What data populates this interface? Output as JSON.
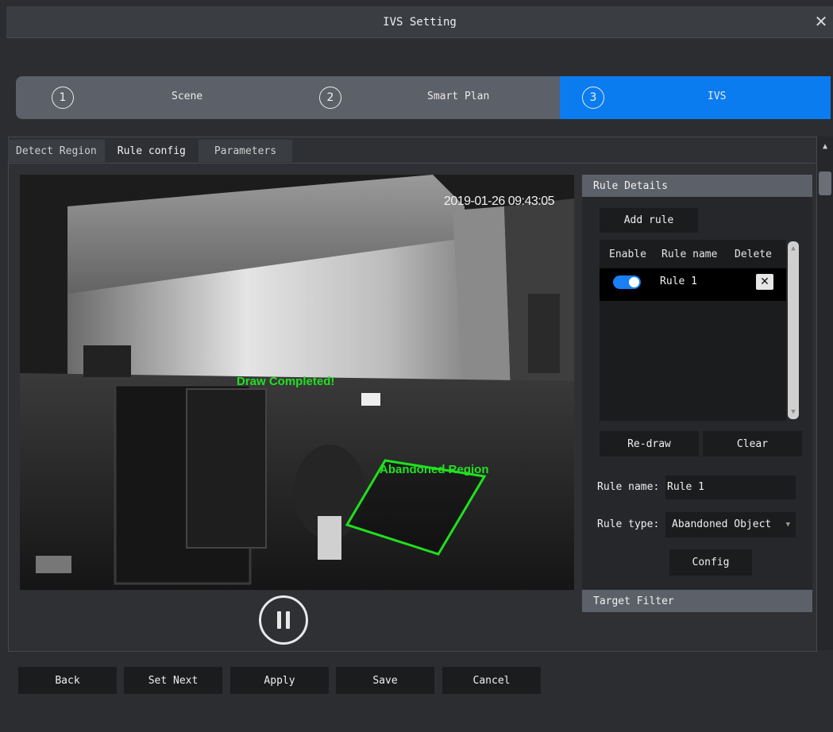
{
  "window": {
    "title": "IVS Setting",
    "close_icon": "close-icon"
  },
  "steps": [
    {
      "number": "1",
      "label": "Scene"
    },
    {
      "number": "2",
      "label": "Smart Plan"
    },
    {
      "number": "3",
      "label": "IVS"
    }
  ],
  "tabs": [
    "Detect Region",
    "Rule config",
    "Parameters"
  ],
  "video": {
    "timestamp": "2019-01-26 09:43:05",
    "draw_status": "Draw Completed!",
    "region_label": "Abandoned Region"
  },
  "rule_details": {
    "header": "Rule Details",
    "add_rule": "Add rule",
    "columns": {
      "enable": "Enable",
      "rule_name": "Rule name",
      "delete": "Delete"
    },
    "rules": [
      {
        "name": "Rule 1",
        "enabled": true
      }
    ],
    "delete_icon": "✕",
    "redraw": "Re-draw",
    "clear": "Clear",
    "rule_name_label": "Rule name:",
    "rule_name_value": "Rule 1",
    "rule_type_label": "Rule type:",
    "rule_type_value": "Abandoned Object",
    "config": "Config"
  },
  "target_filter": {
    "header": "Target Filter"
  },
  "footer": {
    "back": "Back",
    "set_next": "Set Next",
    "apply": "Apply",
    "save": "Save",
    "cancel": "Cancel"
  },
  "colors": {
    "accent": "#0a7cf0",
    "draw_green": "#22e022",
    "toggle_on": "#1a7ff5"
  }
}
